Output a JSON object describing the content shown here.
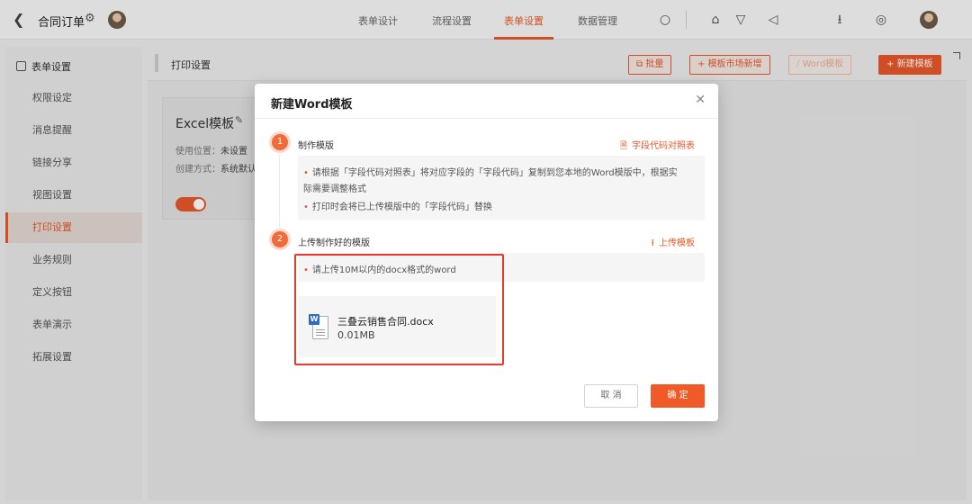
{
  "topbar": {
    "title": "合同订单",
    "tabs": [
      {
        "label": "表单设计",
        "active": false
      },
      {
        "label": "流程设置",
        "active": false
      },
      {
        "label": "表单设置",
        "active": true
      },
      {
        "label": "数据管理",
        "active": false
      }
    ],
    "icons": [
      "search-icon",
      "home-icon",
      "shirt-icon",
      "megaphone-icon",
      "download-icon",
      "settings-icon"
    ]
  },
  "sidebar": {
    "header": "表单设置",
    "items": [
      {
        "label": "权限设定"
      },
      {
        "label": "消息提醒"
      },
      {
        "label": "链接分享"
      },
      {
        "label": "视图设置"
      },
      {
        "label": "打印设置",
        "active": true
      },
      {
        "label": "业务规则"
      },
      {
        "label": "定义按钮"
      },
      {
        "label": "表单演示"
      },
      {
        "label": "拓展设置"
      }
    ]
  },
  "main": {
    "title": "打印设置",
    "buttons": {
      "batch": "批量",
      "market": "模板市场新增",
      "word": "Word模板",
      "new": "新建模板"
    },
    "card": {
      "title": "Excel模板",
      "usage_label": "使用位置：",
      "usage_value": "未设置",
      "create_label": "创建方式：",
      "create_value": "系统默认"
    }
  },
  "modal": {
    "title": "新建Word模板",
    "step1": {
      "num": "1",
      "title": "制作模版",
      "link": "字段代码对照表",
      "lines": [
        "请根据「字段代码对照表」将对应字段的「字段代码」复制到您本地的Word模版中，根据实",
        "际需要调整格式",
        "打印时会将已上传模版中的「字段代码」替换"
      ]
    },
    "step2": {
      "num": "2",
      "title": "上传制作好的模版",
      "link": "上传模板",
      "note": "请上传10M以内的docx格式的word"
    },
    "file": {
      "name": "三叠云销售合同.docx",
      "size": "0.01MB"
    },
    "cancel": "取 消",
    "ok": "确 定"
  },
  "colors": {
    "accent": "#e8572a",
    "highlight": "#e8392a",
    "word_blue": "#2b6cc4"
  }
}
